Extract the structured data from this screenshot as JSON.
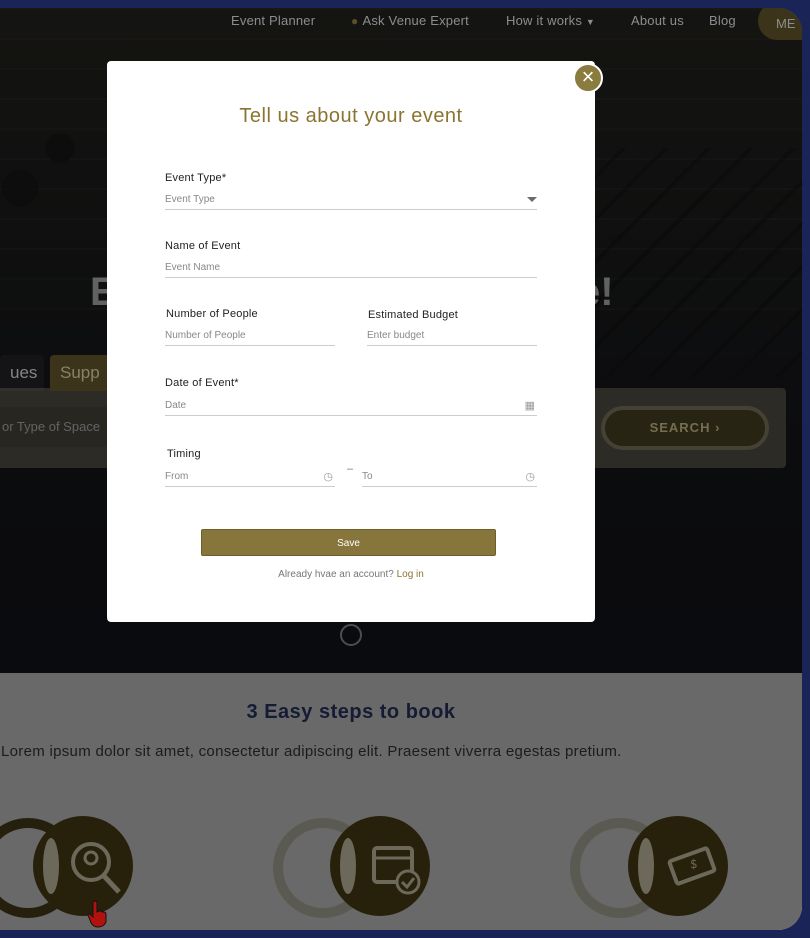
{
  "nav": {
    "items": [
      "Event Planner",
      "Ask Venue Expert",
      "How it works",
      "About us",
      "Blog"
    ],
    "cta": "ME"
  },
  "hero": {
    "title_left": "E",
    "title_right": "e!",
    "tabs": [
      "ues",
      "Supp"
    ],
    "search_placeholder": "or Type of Space",
    "search_button": "SEARCH"
  },
  "steps": {
    "title": "3 Easy steps to book",
    "subtitle": "Lorem ipsum dolor sit amet, consectetur adipiscing elit. Praesent viverra egestas pretium.",
    "icons": [
      "search-location-icon",
      "calendar-check-icon",
      "payment-card-icon"
    ]
  },
  "modal": {
    "title": "Tell us about your event",
    "fields": {
      "event_type": {
        "label": "Event Type*",
        "placeholder": "Event Type"
      },
      "event_name": {
        "label": "Name of Event",
        "placeholder": "Event Name"
      },
      "people": {
        "label": "Number of People",
        "placeholder": "Number of People"
      },
      "budget": {
        "label": "Estimated Budget",
        "placeholder": "Enter budget"
      },
      "date": {
        "label": "Date of Event*",
        "placeholder": "Date"
      },
      "timing": {
        "label": "Timing",
        "from": "From",
        "to": "To",
        "separator": "–"
      }
    },
    "save_label": "Save",
    "login_prompt": "Already hvae an account?",
    "login_link": "Log in"
  },
  "colors": {
    "accent": "#8a7430",
    "button": "#87763c",
    "frame": "#1a2456",
    "heading_blue": "#1f2a4f"
  }
}
